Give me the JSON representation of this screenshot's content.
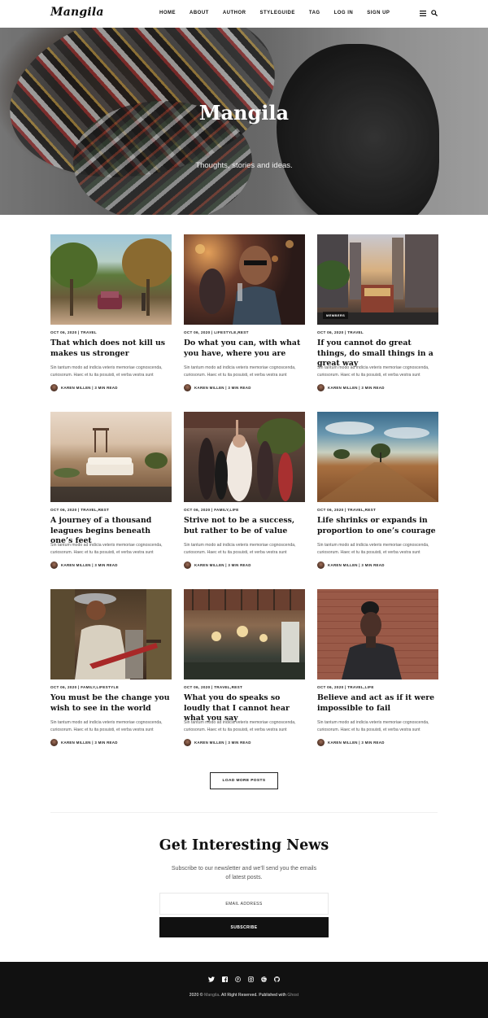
{
  "header": {
    "logo": "Mangila",
    "nav": [
      "HOME",
      "ABOUT",
      "AUTHOR",
      "STYLEGUIDE",
      "TAG",
      "LOG IN",
      "SIGN UP"
    ]
  },
  "hero": {
    "title": "Mangila",
    "subtitle": "Thoughts, stories and ideas."
  },
  "posts": [
    {
      "meta": "OCT 06, 2020 | TRAVEL",
      "title": "That which does not kill us makes us stronger",
      "excerpt": "Sin tantum modo ad indicia veteris memoriae cognoscenda, curiosorum. Haec et tu ita posuisti, et verba vestra sunt",
      "author": "KAREN MILLEN | 3 MIN READ",
      "badge": ""
    },
    {
      "meta": "OCT 06, 2020 | LIFESTYLE,REST",
      "title": "Do what you can, with what you have, where you are",
      "excerpt": "Sin tantum modo ad indicia veteris memoriae cognoscenda, curiosorum. Haec et tu ita posuisti, et verba vestra sunt",
      "author": "KAREN MILLEN | 3 MIN READ",
      "badge": ""
    },
    {
      "meta": "OCT 06, 2020 | TRAVEL",
      "title": "If you cannot do great things, do small things in a great way",
      "excerpt": "Sin tantum modo ad indicia veteris memoriae cognoscenda, curiosorum. Haec et tu ita posuisti, et verba vestra sunt",
      "author": "KAREN MILLEN | 3 MIN READ",
      "badge": "MEMBERS"
    },
    {
      "meta": "OCT 06, 2020 | TRAVEL,REST",
      "title": "A journey of a thousand leagues begins beneath one’s feet",
      "excerpt": "Sin tantum modo ad indicia veteris memoriae cognoscenda, curiosorum. Haec et tu ita posuisti, et verba vestra sunt",
      "author": "KAREN MILLEN | 3 MIN READ",
      "badge": ""
    },
    {
      "meta": "OCT 06, 2020 | FAMILY,LIFE",
      "title": "Strive not to be a success, but rather to be of value",
      "excerpt": "Sin tantum modo ad indicia veteris memoriae cognoscenda, curiosorum. Haec et tu ita posuisti, et verba vestra sunt",
      "author": "KAREN MILLEN | 3 MIN READ",
      "badge": ""
    },
    {
      "meta": "OCT 06, 2020 | TRAVEL,REST",
      "title": "Life shrinks or expands in proportion to one’s courage",
      "excerpt": "Sin tantum modo ad indicia veteris memoriae cognoscenda, curiosorum. Haec et tu ita posuisti, et verba vestra sunt",
      "author": "KAREN MILLEN | 3 MIN READ",
      "badge": ""
    },
    {
      "meta": "OCT 06, 2020 | FAMILY,LIFESTYLE",
      "title": "You must be the change you wish to see in the world",
      "excerpt": "Sin tantum modo ad indicia veteris memoriae cognoscenda, curiosorum. Haec et tu ita posuisti, et verba vestra sunt",
      "author": "KAREN MILLEN | 3 MIN READ",
      "badge": ""
    },
    {
      "meta": "OCT 06, 2020 | TRAVEL,REST",
      "title": "What you do speaks so loudly that I cannot hear what you say",
      "excerpt": "Sin tantum modo ad indicia veteris memoriae cognoscenda, curiosorum. Haec et tu ita posuisti, et verba vestra sunt",
      "author": "KAREN MILLEN | 3 MIN READ",
      "badge": ""
    },
    {
      "meta": "OCT 06, 2020 | TRAVEL,LIFE",
      "title": "Believe and act as if it were impossible to fail",
      "excerpt": "Sin tantum modo ad indicia veteris memoriae cognoscenda, curiosorum. Haec et tu ita posuisti, et verba vestra sunt",
      "author": "KAREN MILLEN | 3 MIN READ",
      "badge": ""
    }
  ],
  "load_more": "LOAD MORE POSTS",
  "newsletter": {
    "title": "Get Interesting News",
    "description": "Subscribe to our newsletter and we’ll send you the emails of latest posts.",
    "placeholder": "EMAIL ADDRESS",
    "button": "SUBSCRIBE"
  },
  "footer": {
    "social_icons": [
      "twitter-icon",
      "facebook-icon",
      "pinterest-icon",
      "instagram-icon",
      "dribbble-icon",
      "github-icon"
    ],
    "copyright_prefix": "2020 © ",
    "copyright_site": "Mangila",
    "copyright_middle": ". All Right Reserved. Published with ",
    "copyright_platform": "Ghost"
  }
}
